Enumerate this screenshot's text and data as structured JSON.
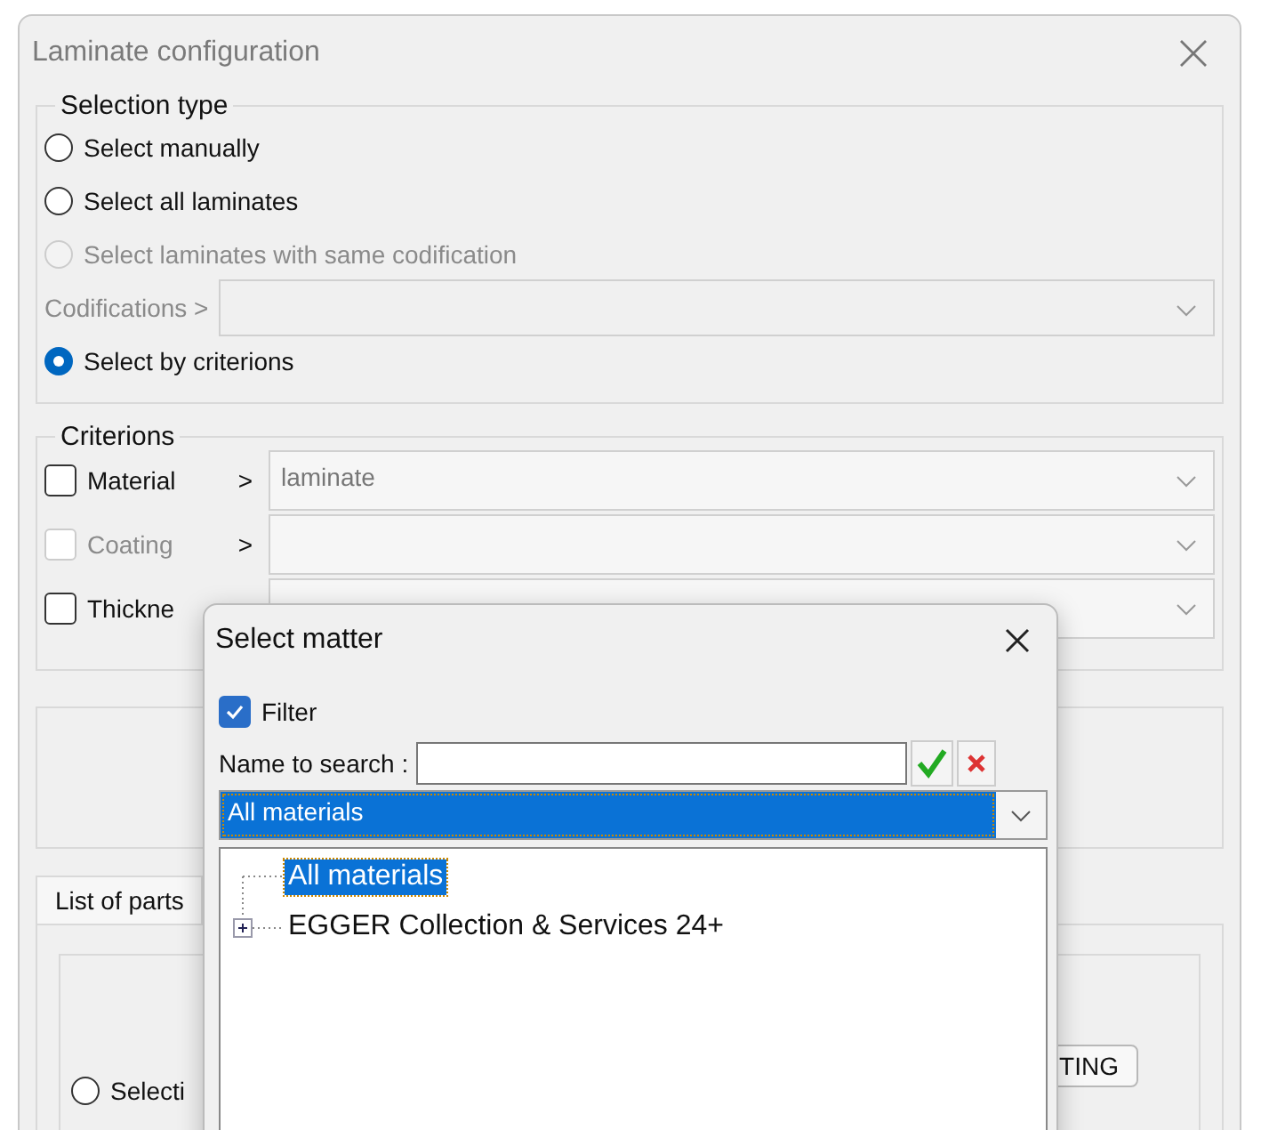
{
  "window": {
    "title": "Laminate configuration"
  },
  "selection_type": {
    "label": "Selection type",
    "rows": [
      {
        "kind": "radio",
        "label": "Select manually",
        "selected": false,
        "disabled": false
      },
      {
        "kind": "radio",
        "label": "Select all laminates",
        "selected": false,
        "disabled": false
      },
      {
        "kind": "radio",
        "label": "Select laminates with same codification",
        "selected": false,
        "disabled": true
      },
      {
        "kind": "combo",
        "label": "Codifications >",
        "disabled": true
      },
      {
        "kind": "radio",
        "label": "Select by criterions",
        "selected": true,
        "disabled": false
      }
    ]
  },
  "criterions": {
    "label": "Criterions",
    "items": [
      {
        "label": "Material",
        "checked": false,
        "disabled": false,
        "arrow": ">",
        "value": "laminate"
      },
      {
        "label": "Coating",
        "checked": false,
        "disabled": true,
        "arrow": ">"
      },
      {
        "label": "Thickne",
        "checked": false,
        "disabled": false
      }
    ]
  },
  "tabs": [
    {
      "label": "List of parts",
      "selected": true
    }
  ],
  "parts": {
    "radio": {
      "label": "Selecti",
      "selected": false
    },
    "button": "TING"
  },
  "dialog": {
    "title": "Select matter",
    "filter": {
      "label": "Filter",
      "checked": true
    },
    "search": {
      "label": "Name to search :"
    },
    "combo": {
      "value": "All materials"
    },
    "tree": [
      {
        "label": "All materials",
        "selected": true
      },
      {
        "label": "EGGER Collection & Services 24+",
        "selected": false,
        "expanded": false
      }
    ]
  }
}
